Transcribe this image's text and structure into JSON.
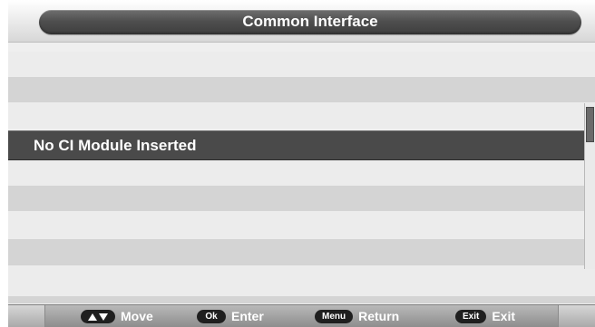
{
  "screen": {
    "title": "Common Interface",
    "message": "No CI Module Inserted"
  },
  "footer": {
    "move": {
      "label": "Move",
      "icon": "up-down-arrows-icon"
    },
    "enter": {
      "key": "Ok",
      "label": "Enter"
    },
    "return": {
      "key": "Menu",
      "label": "Return"
    },
    "exit": {
      "key": "Exit",
      "label": "Exit"
    }
  },
  "colors": {
    "title_bar": "#4f4f4f",
    "selected_row": "#4a4a4a",
    "light_row": "#ececec",
    "mid_row": "#d4d4d4",
    "footer": "#9b9b9b"
  }
}
